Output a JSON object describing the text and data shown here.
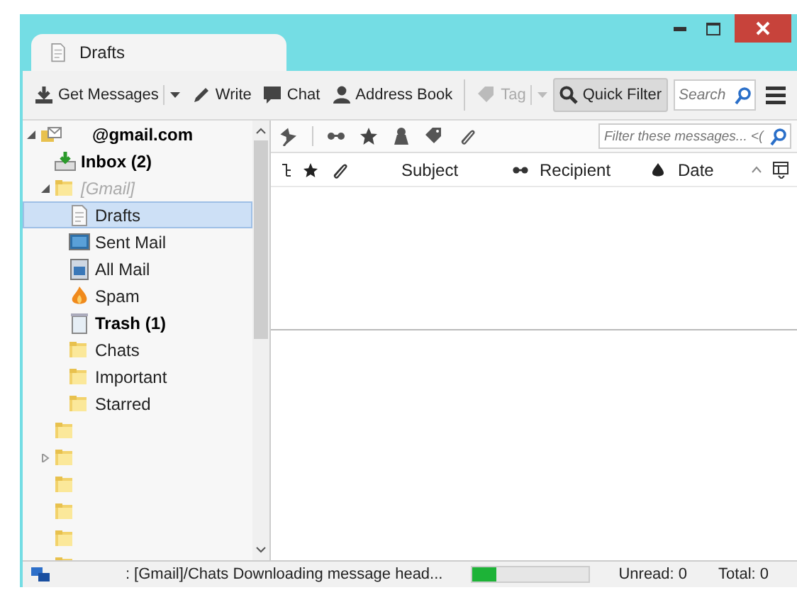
{
  "tabs": [
    {
      "label": "Drafts",
      "selected": true
    }
  ],
  "toolbar": {
    "groups": [
      [
        {
          "label": "Get Messages",
          "dropdown": true,
          "pressed": false,
          "disabled": false
        },
        {
          "label": "Write",
          "dropdown": false,
          "pressed": false,
          "disabled": false
        },
        {
          "label": "Chat",
          "dropdown": false,
          "pressed": false,
          "disabled": false
        },
        {
          "label": "Address Book",
          "dropdown": false,
          "pressed": false,
          "disabled": false
        }
      ],
      [
        {
          "label": "Tag",
          "dropdown": true,
          "pressed": false,
          "disabled": true
        },
        {
          "label": "Quick Filter",
          "dropdown": false,
          "pressed": true,
          "disabled": false
        }
      ]
    ],
    "search": {
      "placeholder": "Search"
    }
  },
  "folders": [
    {
      "kind": "account",
      "label": "@gmail.com",
      "bold": true,
      "selected": false,
      "expanded": true,
      "children": [
        {
          "kind": "inbox",
          "label": "Inbox (2)",
          "bold": true,
          "selected": false
        },
        {
          "kind": "container",
          "label": "[Gmail]",
          "bold": false,
          "selected": false,
          "expanded": true,
          "children": [
            {
              "kind": "drafts",
              "label": "Drafts",
              "bold": false,
              "selected": true
            },
            {
              "kind": "sent",
              "label": "Sent Mail",
              "bold": false,
              "selected": false
            },
            {
              "kind": "archive",
              "label": "All Mail",
              "bold": false,
              "selected": false
            },
            {
              "kind": "spam",
              "label": "Spam",
              "bold": false,
              "selected": false
            },
            {
              "kind": "trash",
              "label": "Trash (1)",
              "bold": true,
              "selected": false
            },
            {
              "kind": "folder",
              "label": "Chats",
              "bold": false,
              "selected": false
            },
            {
              "kind": "folder",
              "label": "Important",
              "bold": false,
              "selected": false
            },
            {
              "kind": "folder",
              "label": "Starred",
              "bold": false,
              "selected": false
            }
          ]
        },
        {
          "kind": "folder",
          "selected": false
        },
        {
          "kind": "folder",
          "selected": false,
          "expanded": false
        },
        {
          "kind": "folder",
          "selected": false
        },
        {
          "kind": "folder",
          "selected": false
        },
        {
          "kind": "folder",
          "selected": false
        },
        {
          "kind": "folder",
          "selected": false
        }
      ]
    }
  ],
  "filter": {
    "placeholder": "Filter these messages... <("
  },
  "columns": [
    {
      "label": "Subject",
      "sorted": false
    },
    {
      "label": "Recipient",
      "sorted": false
    },
    {
      "label": "Date",
      "sorted": true
    }
  ],
  "status_bar": {
    "text": ": [Gmail]/Chats Downloading message head...",
    "level": 0.2,
    "unread": "Unread: 0",
    "total": "Total: 0"
  }
}
